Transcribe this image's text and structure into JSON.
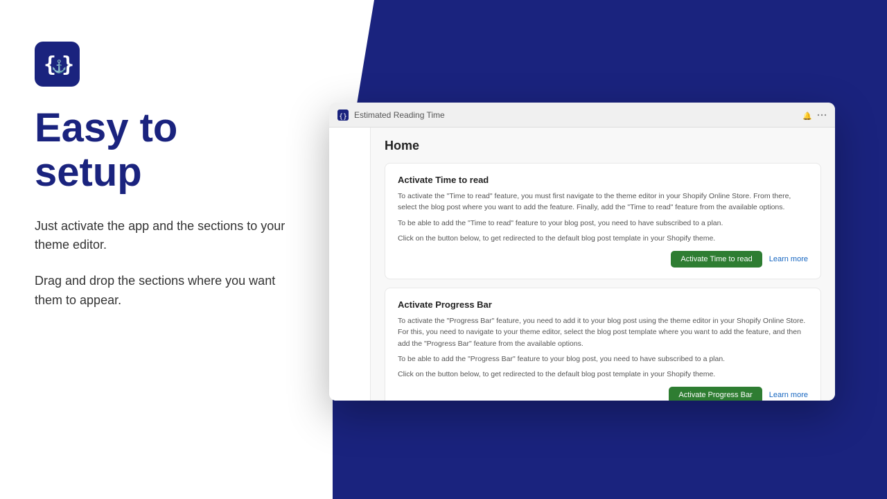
{
  "logo": {
    "alt": "OpenAPI Logo"
  },
  "left": {
    "headline_line1": "Easy to",
    "headline_line2": "setup",
    "para1": "Just activate the app and the sections to your theme editor.",
    "para2": "Drag and drop the sections where you want them to appear."
  },
  "app_window": {
    "title": "Estimated Reading Time",
    "card1": {
      "title": "Activate Time to read",
      "text1": "To activate the \"Time to read\" feature, you must first navigate to the theme editor in your Shopify Online Store. From there, select the blog post where you want to add the feature. Finally, add the \"Time to read\" feature from the available options.",
      "text2": "To be able to add the \"Time to read\" feature to your blog post, you need to have subscribed to a plan.",
      "text3": "Click on the button below, to get redirected to the default blog post template in your Shopify theme.",
      "btn_primary": "Activate Time to read",
      "btn_link": "Learn more"
    },
    "card2": {
      "title": "Activate Progress Bar",
      "text1": "To activate the \"Progress Bar\" feature, you need to add it to your blog post using the theme editor in your Shopify Online Store. For this, you need to navigate to your theme editor, select the blog post template where you want to add the feature, and then add the \"Progress Bar\" feature from the available options.",
      "text2": "To be able to add the \"Progress Bar\" feature to your blog post, you need to have subscribed to a plan.",
      "text3": "Click on the button below, to get redirected to the default blog post template in your Shopify theme.",
      "btn_primary": "Activate Progress Bar",
      "btn_link": "Learn more"
    },
    "home_label": "Home"
  },
  "colors": {
    "brand_dark": "#1a237e",
    "brand_medium": "#3949ab",
    "green": "#2e7d32"
  }
}
